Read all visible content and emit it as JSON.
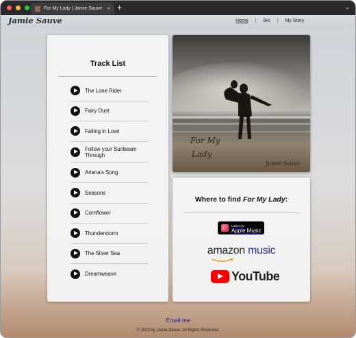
{
  "browser": {
    "tab_title": "For My Lady | Jamie Sauve",
    "tab_close": "×",
    "new_tab": "+",
    "menu_chevron": "⌄"
  },
  "site": {
    "brand": "Jamie Sauve",
    "nav": [
      {
        "label": "Home"
      },
      {
        "label": "Bio"
      },
      {
        "label": "My Story"
      }
    ],
    "nav_sep": "|"
  },
  "tracklist": {
    "title": "Track List",
    "tracks": [
      "The Lone Rider",
      "Fairy Dust",
      "Falling in Love",
      "Follow your Sunbeam Through",
      "Ariana's Song",
      "Seasons",
      "Cornflower",
      "Thunderstorm",
      "The Silver Sea",
      "Dreamweave"
    ]
  },
  "album": {
    "title_line1": "For My",
    "title_line2": "Lady",
    "artist": "Jamie Sauve"
  },
  "where": {
    "prefix": "Where to find ",
    "album": "For My Lady",
    "suffix": ":",
    "apple_small": "Listen on",
    "apple_big": "Apple Music",
    "amazon_word": "amazon",
    "amazon_music": " music",
    "youtube": "YouTube"
  },
  "footer": {
    "email": "Email me",
    "copyright": "© 2023 by Jamie Sauve. All Rights Reserved."
  },
  "colors": {
    "accent_link": "#1a1aa0",
    "youtube_red": "#ff0000",
    "titlebar": "#2a2a2c"
  }
}
